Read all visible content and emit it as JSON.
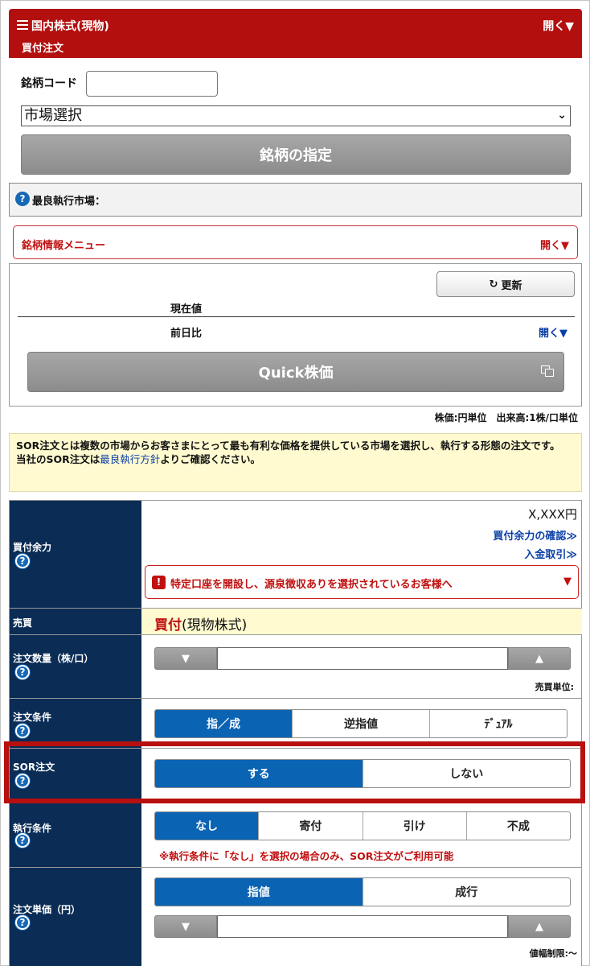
{
  "header": {
    "title": "国内株式(現物)",
    "subtitle": "買付注文",
    "open_label": "開く▼",
    "brand_color": "#b30f0f"
  },
  "search": {
    "code_label": "銘柄コード",
    "code_value": "",
    "market_select": "市場選択",
    "specify_button": "銘柄の指定"
  },
  "best_market": {
    "label": "最良執行市場："
  },
  "info_menu": {
    "label": "銘柄情報メニュー",
    "open_label": "開く▼"
  },
  "quote": {
    "refresh": "更新",
    "current_price": "現在値",
    "prev_day": "前日比",
    "open_label": "開く▼",
    "quick_button": "Quick株価",
    "units": "株価:円単位　出来高:1株/口単位"
  },
  "notice": {
    "line1": "SOR注文とは複数の市場からお客さまにとって最も有利な価格を提供している市場を選択し、執行する形態の注文です。",
    "line2_pre": "当社のSOR注文は",
    "line2_link": "最良執行方針",
    "line2_post": "よりご確認ください。"
  },
  "form": {
    "buying_power": {
      "label": "買付余力",
      "value": "X,XXX円",
      "link1": "買付余力の確認≫",
      "link2": "入金取引≫",
      "alert": "特定口座を開設し、源泉徴収ありを選択されているお客様へ",
      "alert_arrow": "▼"
    },
    "trade": {
      "label": "売買",
      "value_main": "買付",
      "value_sub": "(現物株式)"
    },
    "quantity": {
      "label": "注文数量（株/口）",
      "value": "",
      "unit_label": "売買単位:"
    },
    "condition": {
      "label": "注文条件",
      "options": [
        "指／成",
        "逆指値",
        "ﾃﾞｭｱﾙ"
      ],
      "selected": "指／成"
    },
    "sor": {
      "label": "SOR注文",
      "options": [
        "する",
        "しない"
      ],
      "selected": "する"
    },
    "exec": {
      "label": "執行条件",
      "options": [
        "なし",
        "寄付",
        "引け",
        "不成"
      ],
      "selected": "なし",
      "note": "※執行条件に「なし」を選択の場合のみ、SOR注文がご利用可能"
    },
    "price": {
      "label": "注文単価（円）",
      "options": [
        "指値",
        "成行"
      ],
      "selected": "指値",
      "value": "",
      "limit_label": "値幅制限:～"
    }
  },
  "icons": {
    "question": "?",
    "refresh": "↻",
    "down": "▼",
    "up": "▲",
    "alert": "!"
  },
  "colors": {
    "highlight_border": "#b80f0f",
    "navy": "#0a2c55",
    "blue": "#0a63b3",
    "notice_bg": "#fffad0"
  }
}
